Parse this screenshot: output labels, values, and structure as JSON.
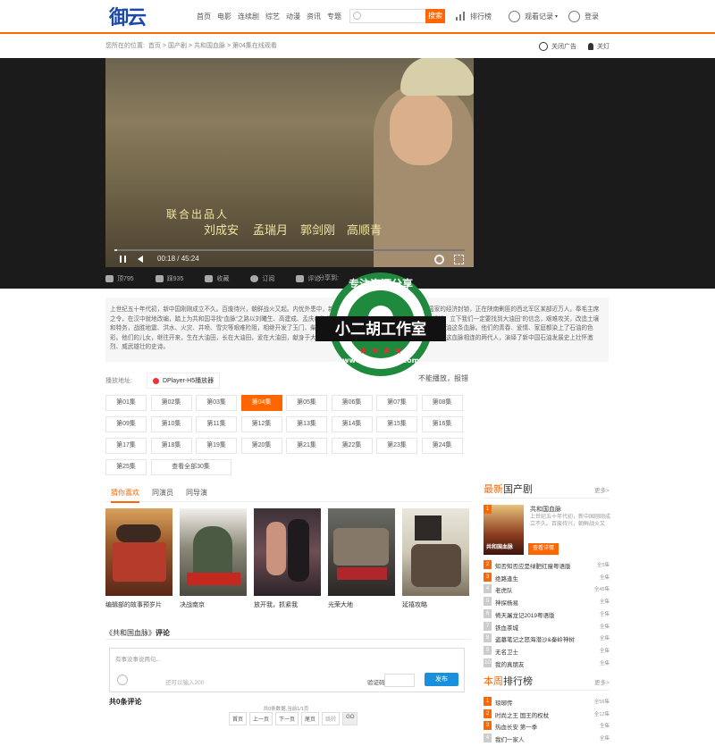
{
  "header": {
    "logo": "御云",
    "nav": [
      "首页",
      "电影",
      "连续剧",
      "综艺",
      "动漫",
      "资讯",
      "专题"
    ],
    "search_placeholder": "",
    "search_btn": "搜索",
    "ranking": "排行榜",
    "history": "观看记录",
    "login": "登录"
  },
  "breadcrumb": {
    "prefix": "您所在的位置:",
    "items": [
      "首页",
      "国产剧",
      "共和国血脉",
      "第04集在线观看"
    ]
  },
  "tools": {
    "close_ad": "关闭广告",
    "lights_off": "关灯"
  },
  "player": {
    "subtitle_top": "联合出品人",
    "subtitle_names": [
      "刘成安",
      "孟瑞月",
      "郭剑刚",
      "高顺青"
    ],
    "time": "00:18 / 45:24",
    "progress": 0.0066
  },
  "actions": {
    "up": "顶795",
    "down": "踩935",
    "fav": "收藏",
    "sub": "订阅",
    "comment": "评论",
    "share": "分享到:"
  },
  "description": "上世纪五十年代初，新中国刚刚成立不久。百废待兴，朝鲜战火又起。内忧外患中，新中国急需石油来发展。为了打破西方国家的经济封锁，正在陕南剿匪的西北军区某部近万人，奉毛主席之令，在汉中就地改编，踏上为共和国寻找“血脉”之路以刘曦生、高建成、孟庆山为代表的西北石油人，满怀着新中国人民的期望，立下我们一定要找到大油田”的信念，艰难攻关，改造土壤和特务，战胜地震、洪水、火灾、井喷、雪灾等艰难险阻，相继开发了玉门、柴达木、克拉玛依、四川等油田，为共和国开发了石油这条血脉。他们的青春、爱情、家庭都染上了石油的色彩。他们的儿女，继往开来，生在大油田，长在大油田，爱在大油田，献身于大油田，创造了一个又一个奇迹，建起了大庆油田！这血脉相连的两代人，演绎了新中国石油发展史上壮怀激烈、威武雄壮的史诗。",
  "play_source": {
    "label": "播放地址:",
    "source": "DPlayer-H5播放器",
    "report": "不能播放，报错"
  },
  "episodes": [
    "第01集",
    "第02集",
    "第03集",
    "第04集",
    "第05集",
    "第06集",
    "第07集",
    "第08集",
    "第09集",
    "第10集",
    "第11集",
    "第12集",
    "第13集",
    "第14集",
    "第15集",
    "第16集",
    "第17集",
    "第18集",
    "第19集",
    "第20集",
    "第21集",
    "第22集",
    "第23集",
    "第24集",
    "第25集"
  ],
  "episodes_current": "第04集",
  "episodes_all": "查看全部30集",
  "tabs": [
    "猜你喜欢",
    "同演员",
    "同导演"
  ],
  "recommend": [
    {
      "title": "编辑部的故事预岁片"
    },
    {
      "title": "决战南京"
    },
    {
      "title": "放开我，抓紧我"
    },
    {
      "title": "光荣大地"
    },
    {
      "title": "延禧攻略"
    }
  ],
  "comments": {
    "title_prefix": "《共和国血脉》",
    "title_suffix": "评论",
    "placeholder": "有事没事说两句...",
    "limit": "还可以输入200",
    "code_label": "验证码",
    "post": "发布",
    "count": "共0条评论",
    "pager_info": "共0条数据,当前1/1页",
    "pager": [
      "首页",
      "上一页",
      "下一页",
      "尾页"
    ],
    "page_input": "跳转",
    "go": "GO"
  },
  "sidebar": {
    "latest_prefix": "最新",
    "latest_suffix": "国产剧",
    "more": "更多>",
    "featured": {
      "no": "1",
      "title": "共和国血脉",
      "desc": "上世纪五十年代初，新中国刚刚成立不久。百废待兴，朝鲜战火又",
      "btn": "查看详情",
      "poster_text": "共和国血脉"
    },
    "latest": [
      {
        "no": "2",
        "name": "知否知否应是绿肥红瘦粤语版",
        "right": "全5集"
      },
      {
        "no": "3",
        "name": "绝路逢生",
        "right": "全集"
      },
      {
        "no": "4",
        "name": "老虎队",
        "right": "全45集"
      },
      {
        "no": "5",
        "name": "神探杨易",
        "right": "全集"
      },
      {
        "no": "6",
        "name": "倚天屠龙记2019粤语版",
        "right": "全集"
      },
      {
        "no": "7",
        "name": "铁血茶城",
        "right": "全集"
      },
      {
        "no": "8",
        "name": "盗墓笔记之怒海潜沙&秦岭神树",
        "right": "全集"
      },
      {
        "no": "9",
        "name": "无名卫士",
        "right": "全集"
      },
      {
        "no": "10",
        "name": "我的真朋友",
        "right": "全集"
      }
    ],
    "week_prefix": "本周",
    "week_suffix": "排行榜",
    "week": [
      {
        "no": "1",
        "name": "琅琊传",
        "right": "全56集"
      },
      {
        "no": "2",
        "name": "时尚之王 国王的权杖",
        "right": "全12集"
      },
      {
        "no": "3",
        "name": "热血长安 第一季",
        "right": "全集"
      },
      {
        "no": "4",
        "name": "我们一家人",
        "right": "全集"
      }
    ]
  },
  "watermark": {
    "top": "专注资源分享",
    "middle": "小二胡工作室",
    "bottom": "www.xiaoerhu.com"
  },
  "colors": {
    "accent": "#ff6600",
    "player_bg": "#1b1b1b",
    "post_btn": "#1a8fdc",
    "watermark_green": "#1f8a3d"
  }
}
